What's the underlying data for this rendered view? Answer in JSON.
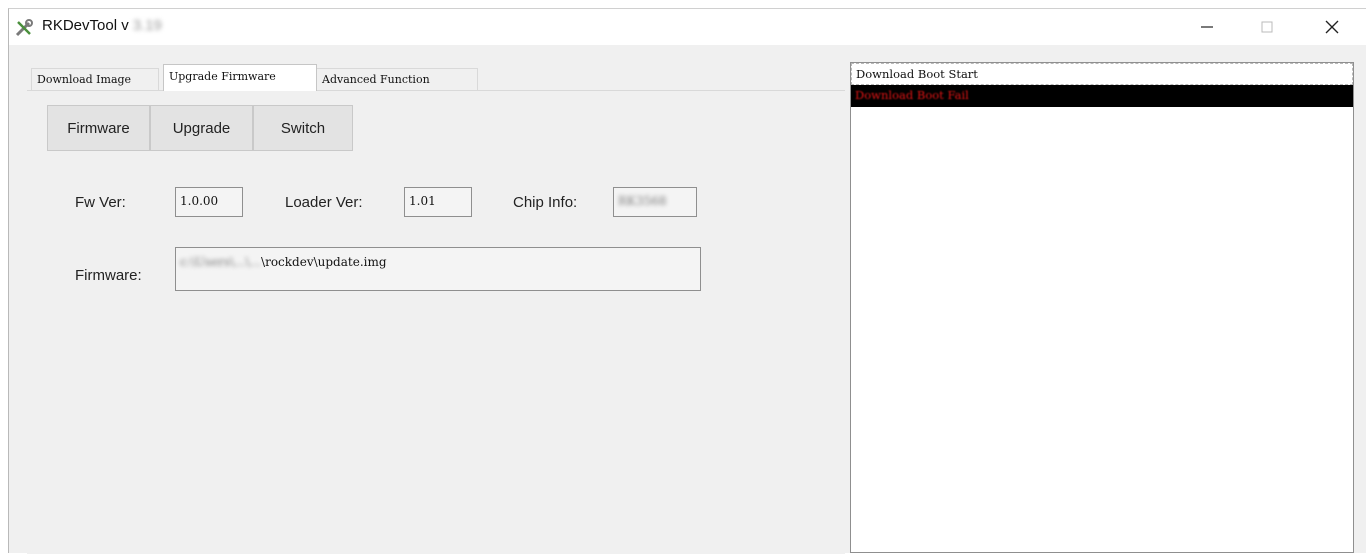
{
  "window": {
    "title": "RKDevTool v",
    "title_version": "3.19"
  },
  "tabs": [
    {
      "label": "Download Image",
      "active": false
    },
    {
      "label": "Upgrade Firmware",
      "active": true
    },
    {
      "label": "Advanced Function",
      "active": false
    }
  ],
  "toolbar": {
    "firmware_label": "Firmware",
    "upgrade_label": "Upgrade",
    "switch_label": "Switch"
  },
  "info": {
    "fw_ver_label": "Fw Ver:",
    "fw_ver_value": "1.0.00",
    "loader_ver_label": "Loader Ver:",
    "loader_ver_value": "1.01",
    "chip_info_label": "Chip Info:",
    "chip_info_value": "RK3568",
    "firmware_label": "Firmware:",
    "firmware_path_prefix": "c:\\Users\\...\\...",
    "firmware_path_suffix": "\\rockdev\\update.img"
  },
  "log": {
    "lines": [
      {
        "text": "Download Boot Start",
        "status": "normal"
      },
      {
        "text": "Download Boot Fail",
        "status": "error"
      }
    ]
  },
  "colors": {
    "window_bg": "#f0f0f0",
    "log_error_fg": "#e01414",
    "log_error_bg": "#000000"
  }
}
